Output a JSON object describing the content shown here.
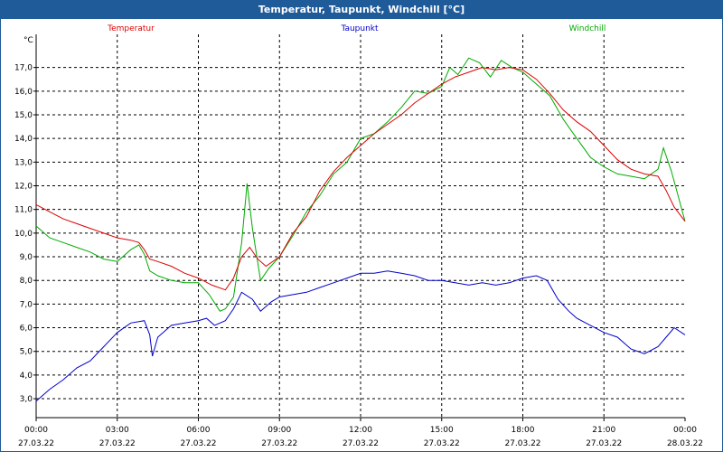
{
  "window": {
    "title": "Temperatur, Taupunkt, Windchill [°C]"
  },
  "chart_data": {
    "type": "line",
    "title": "Temperatur, Taupunkt, Windchill [°C]",
    "ylabel": "°C",
    "ylim": [
      2.2,
      18.4
    ],
    "yticks": [
      3,
      4,
      5,
      6,
      7,
      8,
      9,
      10,
      11,
      12,
      13,
      14,
      15,
      16,
      17
    ],
    "ytick_labels": [
      "3,0",
      "4,0",
      "5,0",
      "6,0",
      "7,0",
      "8,0",
      "9,0",
      "10,0",
      "11,0",
      "12,0",
      "13,0",
      "14,0",
      "15,0",
      "16,0",
      "17,0"
    ],
    "xlim": [
      0,
      24
    ],
    "xticks": [
      0,
      3,
      6,
      9,
      12,
      15,
      18,
      21,
      24
    ],
    "xtick_times": [
      "00:00",
      "03:00",
      "06:00",
      "09:00",
      "12:00",
      "15:00",
      "18:00",
      "21:00",
      "00:00"
    ],
    "xtick_dates": [
      "27.03.22",
      "27.03.22",
      "27.03.22",
      "27.03.22",
      "27.03.22",
      "27.03.22",
      "27.03.22",
      "27.03.22",
      "28.03.22"
    ],
    "grid": true,
    "legend_position": "top",
    "series": [
      {
        "name": "Temperatur",
        "color": "#dd0000",
        "points": [
          [
            0,
            11.2
          ],
          [
            0.5,
            10.9
          ],
          [
            1,
            10.6
          ],
          [
            1.5,
            10.4
          ],
          [
            2,
            10.2
          ],
          [
            2.5,
            10.0
          ],
          [
            3,
            9.8
          ],
          [
            3.5,
            9.7
          ],
          [
            3.8,
            9.6
          ],
          [
            4.0,
            9.3
          ],
          [
            4.2,
            8.9
          ],
          [
            4.5,
            8.8
          ],
          [
            5,
            8.6
          ],
          [
            5.5,
            8.3
          ],
          [
            6,
            8.1
          ],
          [
            6.5,
            7.8
          ],
          [
            7,
            7.6
          ],
          [
            7.3,
            8.1
          ],
          [
            7.6,
            9.0
          ],
          [
            7.9,
            9.4
          ],
          [
            8.2,
            8.9
          ],
          [
            8.5,
            8.6
          ],
          [
            9,
            9.0
          ],
          [
            9.5,
            10.0
          ],
          [
            10,
            10.7
          ],
          [
            10.5,
            11.8
          ],
          [
            11,
            12.6
          ],
          [
            11.5,
            13.2
          ],
          [
            12,
            13.7
          ],
          [
            12.5,
            14.2
          ],
          [
            13,
            14.6
          ],
          [
            13.5,
            15.0
          ],
          [
            14,
            15.5
          ],
          [
            14.5,
            15.9
          ],
          [
            15,
            16.3
          ],
          [
            15.5,
            16.6
          ],
          [
            16,
            16.8
          ],
          [
            16.5,
            17.0
          ],
          [
            17,
            16.9
          ],
          [
            17.5,
            17.0
          ],
          [
            18,
            16.9
          ],
          [
            18.5,
            16.5
          ],
          [
            19,
            15.9
          ],
          [
            19.5,
            15.2
          ],
          [
            20,
            14.7
          ],
          [
            20.5,
            14.3
          ],
          [
            21,
            13.7
          ],
          [
            21.5,
            13.1
          ],
          [
            22,
            12.7
          ],
          [
            22.5,
            12.5
          ],
          [
            23,
            12.4
          ],
          [
            23.3,
            11.8
          ],
          [
            23.6,
            11.1
          ],
          [
            24,
            10.5
          ]
        ]
      },
      {
        "name": "Taupunkt",
        "color": "#0000cc",
        "points": [
          [
            0,
            2.9
          ],
          [
            0.5,
            3.4
          ],
          [
            1,
            3.8
          ],
          [
            1.5,
            4.3
          ],
          [
            2,
            4.6
          ],
          [
            2.5,
            5.2
          ],
          [
            3,
            5.8
          ],
          [
            3.5,
            6.2
          ],
          [
            4,
            6.3
          ],
          [
            4.2,
            5.7
          ],
          [
            4.3,
            4.8
          ],
          [
            4.5,
            5.6
          ],
          [
            5,
            6.1
          ],
          [
            5.5,
            6.2
          ],
          [
            6,
            6.3
          ],
          [
            6.3,
            6.4
          ],
          [
            6.6,
            6.1
          ],
          [
            7,
            6.3
          ],
          [
            7.3,
            6.8
          ],
          [
            7.6,
            7.5
          ],
          [
            8,
            7.2
          ],
          [
            8.3,
            6.7
          ],
          [
            8.7,
            7.1
          ],
          [
            9,
            7.3
          ],
          [
            9.5,
            7.4
          ],
          [
            10,
            7.5
          ],
          [
            10.5,
            7.7
          ],
          [
            11,
            7.9
          ],
          [
            11.5,
            8.1
          ],
          [
            12,
            8.3
          ],
          [
            12.5,
            8.3
          ],
          [
            13,
            8.4
          ],
          [
            13.5,
            8.3
          ],
          [
            14,
            8.2
          ],
          [
            14.5,
            8.0
          ],
          [
            15,
            8.0
          ],
          [
            15.5,
            7.9
          ],
          [
            16,
            7.8
          ],
          [
            16.5,
            7.9
          ],
          [
            17,
            7.8
          ],
          [
            17.5,
            7.9
          ],
          [
            18,
            8.1
          ],
          [
            18.5,
            8.2
          ],
          [
            18.9,
            8.0
          ],
          [
            19.3,
            7.2
          ],
          [
            19.7,
            6.7
          ],
          [
            20,
            6.4
          ],
          [
            20.5,
            6.1
          ],
          [
            21,
            5.8
          ],
          [
            21.5,
            5.6
          ],
          [
            22,
            5.1
          ],
          [
            22.5,
            4.9
          ],
          [
            23,
            5.2
          ],
          [
            23.3,
            5.6
          ],
          [
            23.6,
            6.0
          ],
          [
            24,
            5.7
          ]
        ]
      },
      {
        "name": "Windchill",
        "color": "#00aa00",
        "points": [
          [
            0,
            10.3
          ],
          [
            0.5,
            9.8
          ],
          [
            1,
            9.6
          ],
          [
            1.5,
            9.4
          ],
          [
            2,
            9.2
          ],
          [
            2.5,
            8.9
          ],
          [
            3,
            8.8
          ],
          [
            3.5,
            9.3
          ],
          [
            3.8,
            9.5
          ],
          [
            4.0,
            9.1
          ],
          [
            4.2,
            8.4
          ],
          [
            4.5,
            8.2
          ],
          [
            5,
            8.0
          ],
          [
            5.5,
            7.9
          ],
          [
            6,
            7.9
          ],
          [
            6.4,
            7.4
          ],
          [
            6.8,
            6.7
          ],
          [
            7,
            6.8
          ],
          [
            7.3,
            7.3
          ],
          [
            7.6,
            9.6
          ],
          [
            7.8,
            12.1
          ],
          [
            8.0,
            10.2
          ],
          [
            8.3,
            8.0
          ],
          [
            8.6,
            8.5
          ],
          [
            9,
            9.0
          ],
          [
            9.5,
            9.9
          ],
          [
            10,
            10.9
          ],
          [
            10.5,
            11.6
          ],
          [
            11,
            12.5
          ],
          [
            11.5,
            13.0
          ],
          [
            12,
            14.0
          ],
          [
            12.5,
            14.2
          ],
          [
            13,
            14.7
          ],
          [
            13.5,
            15.3
          ],
          [
            14,
            16.0
          ],
          [
            14.5,
            15.9
          ],
          [
            15,
            16.2
          ],
          [
            15.3,
            17.0
          ],
          [
            15.6,
            16.7
          ],
          [
            16,
            17.4
          ],
          [
            16.4,
            17.2
          ],
          [
            16.8,
            16.6
          ],
          [
            17.2,
            17.3
          ],
          [
            17.6,
            17.0
          ],
          [
            18,
            16.8
          ],
          [
            18.5,
            16.3
          ],
          [
            19,
            15.8
          ],
          [
            19.5,
            14.8
          ],
          [
            20,
            14.0
          ],
          [
            20.5,
            13.2
          ],
          [
            21,
            12.8
          ],
          [
            21.5,
            12.5
          ],
          [
            22,
            12.4
          ],
          [
            22.5,
            12.3
          ],
          [
            23,
            12.7
          ],
          [
            23.2,
            13.6
          ],
          [
            23.5,
            12.6
          ],
          [
            24,
            10.5
          ]
        ]
      }
    ]
  }
}
